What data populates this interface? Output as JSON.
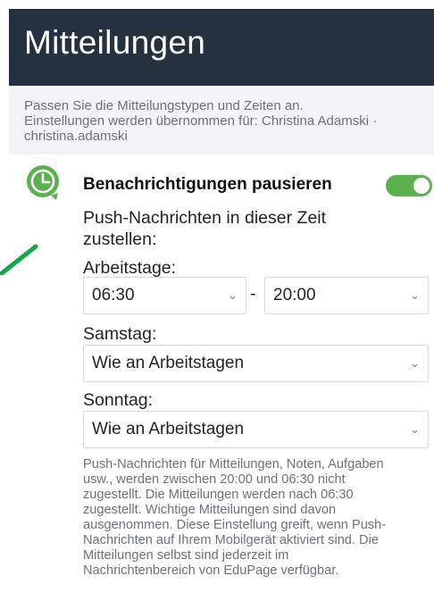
{
  "header": {
    "title": "Mitteilungen"
  },
  "intro": {
    "line1": "Passen Sie die Mitteilungstypen und Zeiten an.",
    "line2": "Einstellungen werden übernommen für: Christina Adamski ·",
    "line3": "christina.adamski"
  },
  "pause": {
    "title": "Benachrichtigungen pausieren",
    "toggle_on": true,
    "push_label_line1": "Push-Nachrichten in dieser Zeit",
    "push_label_line2": "zustellen:"
  },
  "workdays": {
    "label": "Arbeitstage:",
    "from": "06:30",
    "separator": "-",
    "to": "20:00"
  },
  "saturday": {
    "label": "Samstag:",
    "value": "Wie an Arbeitstagen"
  },
  "sunday": {
    "label": "Sonntag:",
    "value": "Wie an Arbeitstagen"
  },
  "footnote": {
    "lines": [
      "Push-Nachrichten für Mitteilungen, Noten, Aufgaben",
      "usw., werden zwischen 20:00 und 06:30 nicht",
      "zugestellt. Die Mitteilungen werden nach 06:30",
      "zugestellt. Wichtige Mitteilungen sind davon",
      "ausgenommen. Diese Einstellung greift, wenn Push-",
      "Nachrichten auf Ihrem Mobilgerät aktiviert sind. Die",
      "Mitteilungen selbst sind jederzeit im",
      "Nachrichtenbereich von EduPage verfügbar."
    ]
  },
  "icons": {
    "pause_icon": "clock-icon",
    "select_chevron": "chevron-down-icon",
    "annotation": "arrow-annotation"
  },
  "colors": {
    "header_bg": "#26313f",
    "accent_green": "#5ab14d",
    "annotation_green": "#11a84a"
  }
}
